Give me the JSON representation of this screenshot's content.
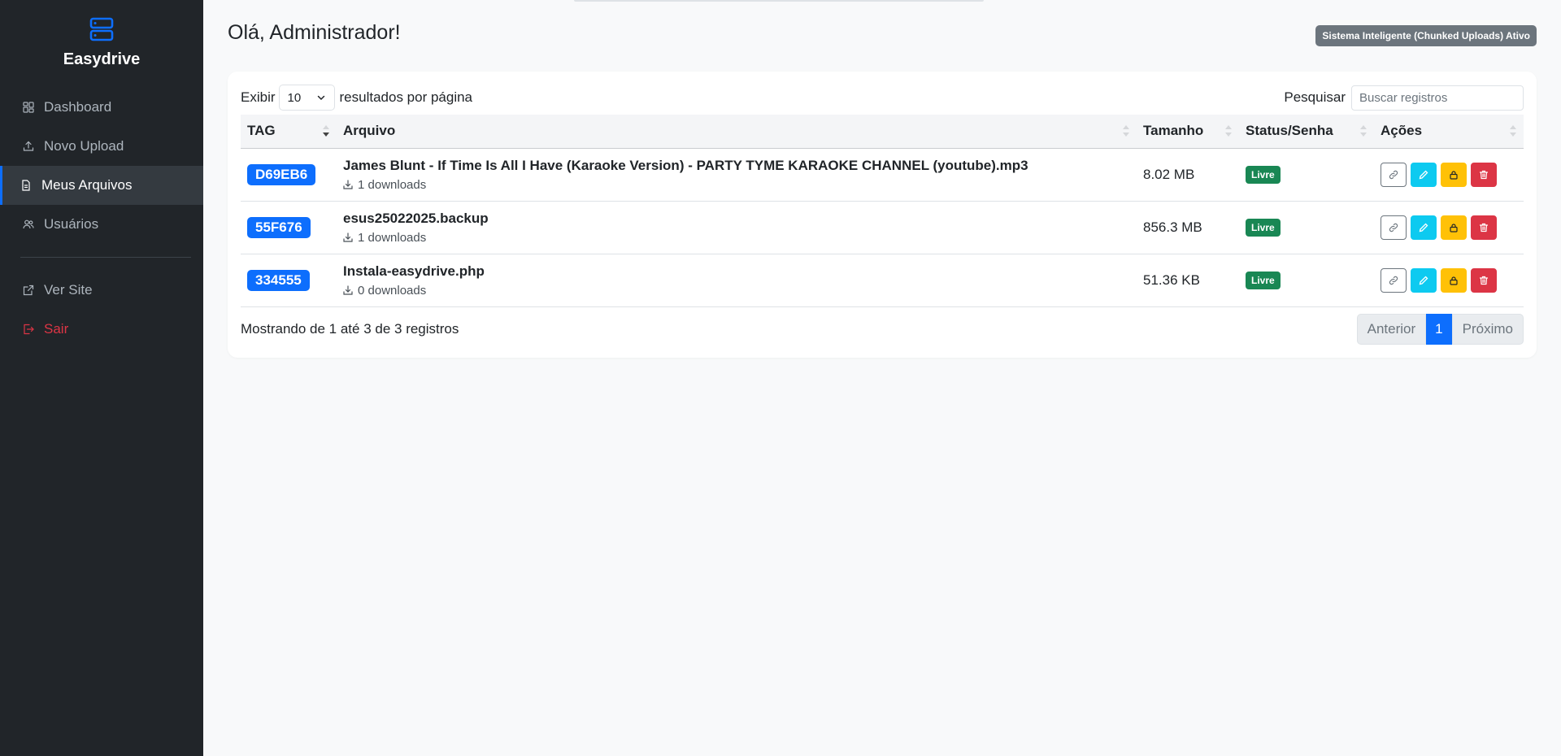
{
  "sidebar": {
    "brand": "Easydrive",
    "items": [
      {
        "label": "Dashboard",
        "icon": "grid-icon"
      },
      {
        "label": "Novo Upload",
        "icon": "upload-icon"
      },
      {
        "label": "Meus Arquivos",
        "icon": "file-icon",
        "active": true
      },
      {
        "label": "Usuários",
        "icon": "users-icon"
      }
    ],
    "secondary": [
      {
        "label": "Ver Site",
        "icon": "external-link-icon"
      },
      {
        "label": "Sair",
        "icon": "logout-icon"
      }
    ]
  },
  "header": {
    "title": "Olá, Administrador!",
    "status_badge": "Sistema Inteligente (Chunked Uploads) Ativo"
  },
  "table_controls": {
    "show_label": "Exibir",
    "page_length": "10",
    "per_page_label": "resultados por página",
    "search_label": "Pesquisar",
    "search_placeholder": "Buscar registros"
  },
  "table": {
    "columns": [
      "TAG",
      "Arquivo",
      "Tamanho",
      "Status/Senha",
      "Ações"
    ],
    "rows": [
      {
        "tag": "D69EB6",
        "name": "James Blunt - If Time Is All I Have (Karaoke Version) - PARTY TYME KARAOKE CHANNEL (youtube).mp3",
        "downloads": "1 downloads",
        "size": "8.02 MB",
        "status": "Livre"
      },
      {
        "tag": "55F676",
        "name": "esus25022025.backup",
        "downloads": "1 downloads",
        "size": "856.3 MB",
        "status": "Livre"
      },
      {
        "tag": "334555",
        "name": "Instala-easydrive.php",
        "downloads": "0 downloads",
        "size": "51.36 KB",
        "status": "Livre"
      }
    ]
  },
  "footer": {
    "info": "Mostrando de 1 até 3 de 3 registros",
    "prev": "Anterior",
    "current_page": "1",
    "next": "Próximo"
  },
  "colors": {
    "sidebar_bg": "#212529",
    "accent": "#0d6efd",
    "success": "#198754",
    "info": "#0dcaf0",
    "warning": "#ffc107",
    "danger": "#dc3545"
  }
}
